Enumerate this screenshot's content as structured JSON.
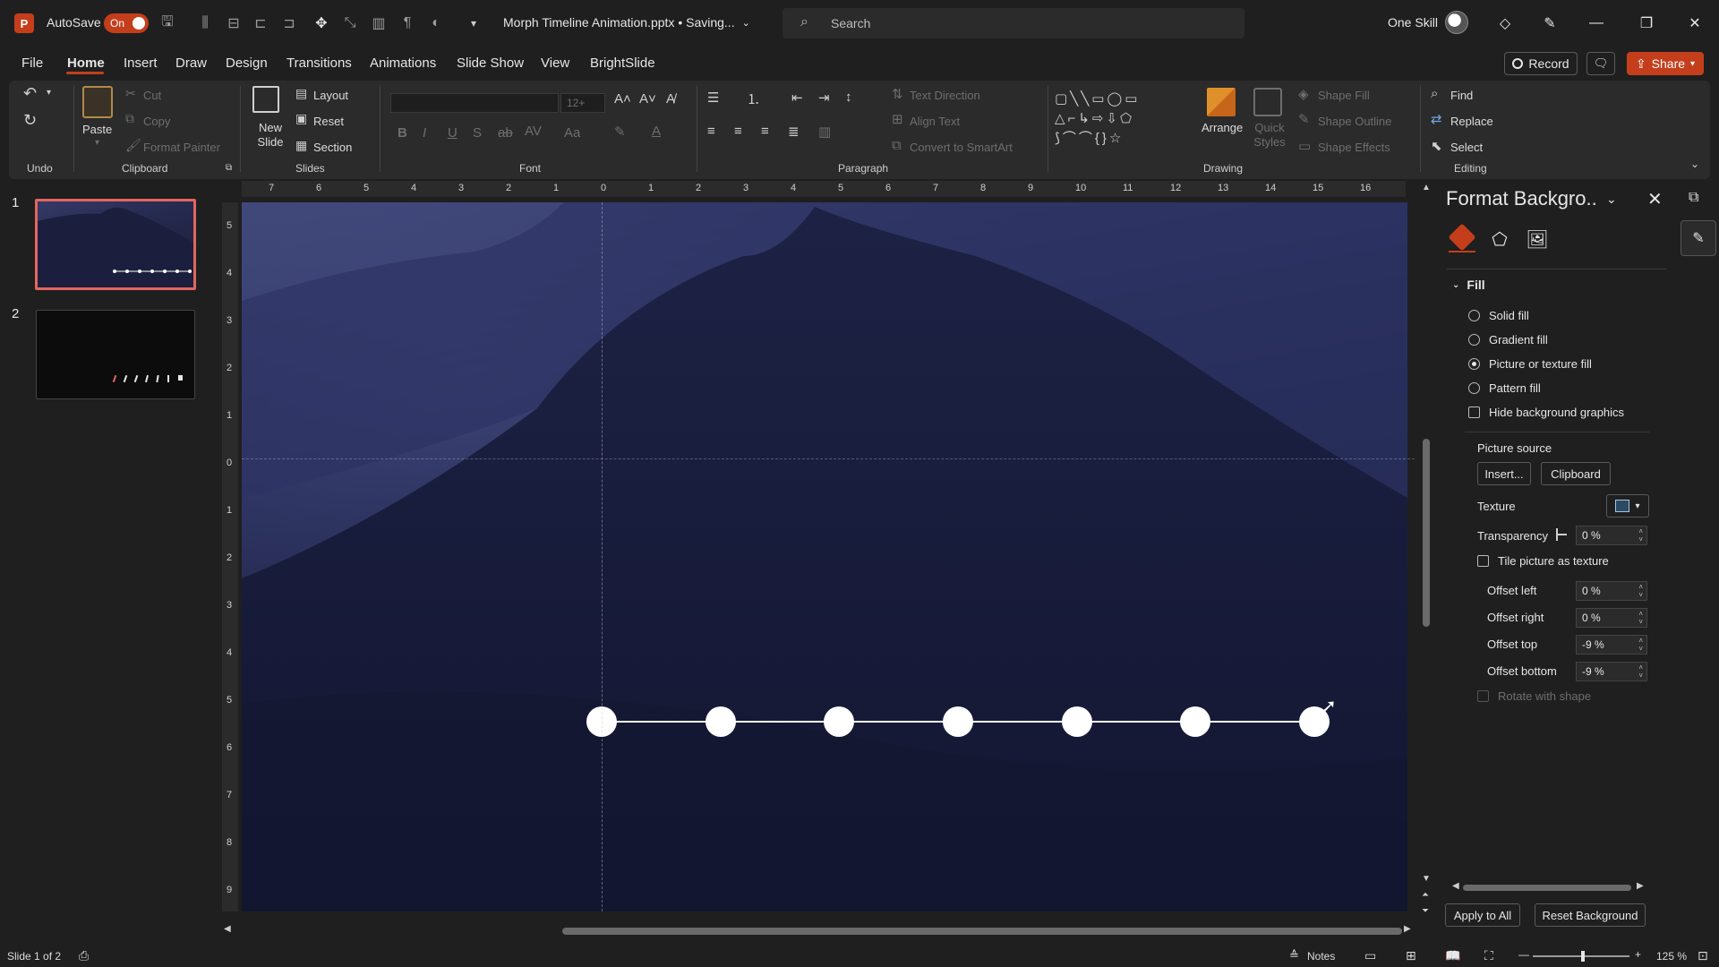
{
  "titlebar": {
    "app_badge": "P",
    "autosave_label": "AutoSave",
    "autosave_state": "On",
    "doc_title": "Morph Timeline Animation.pptx • Saving...",
    "search_placeholder": "Search",
    "user_name": "One Skill"
  },
  "menu": {
    "tabs": [
      "File",
      "Home",
      "Insert",
      "Draw",
      "Design",
      "Transitions",
      "Animations",
      "Slide Show",
      "View",
      "BrightSlide"
    ],
    "active_tab": "Home",
    "record_label": "Record",
    "share_label": "Share"
  },
  "ribbon": {
    "undo_group": "Undo",
    "clipboard": {
      "paste": "Paste",
      "cut": "Cut",
      "copy": "Copy",
      "format_painter": "Format Painter",
      "group": "Clipboard"
    },
    "slides": {
      "new_slide": "New Slide",
      "layout": "Layout",
      "reset": "Reset",
      "section": "Section",
      "group": "Slides"
    },
    "font": {
      "size": "12+",
      "group": "Font"
    },
    "paragraph": {
      "text_direction": "Text Direction",
      "align_text": "Align Text",
      "convert_smartart": "Convert to SmartArt",
      "group": "Paragraph"
    },
    "drawing": {
      "arrange": "Arrange",
      "quick_styles": "Quick Styles",
      "shape_fill": "Shape Fill",
      "shape_outline": "Shape Outline",
      "shape_effects": "Shape Effects",
      "group": "Drawing"
    },
    "editing": {
      "find": "Find",
      "replace": "Replace",
      "select": "Select",
      "group": "Editing"
    }
  },
  "thumbnails": [
    {
      "number": "1",
      "selected": true
    },
    {
      "number": "2",
      "selected": false
    }
  ],
  "rulers": {
    "horizontal": [
      "7",
      "6",
      "5",
      "4",
      "3",
      "2",
      "1",
      "0",
      "1",
      "2",
      "3",
      "4",
      "5",
      "6",
      "7",
      "8",
      "9",
      "10",
      "11",
      "12",
      "13",
      "14",
      "15",
      "16"
    ],
    "vertical": [
      "5",
      "4",
      "3",
      "2",
      "1",
      "0",
      "1",
      "2",
      "3",
      "4",
      "5",
      "6",
      "7",
      "8",
      "9"
    ]
  },
  "timeline": {
    "dot_count": 7,
    "color": "#ffffff"
  },
  "format_pane": {
    "title": "Format Backgro..",
    "section": "Fill",
    "options": [
      {
        "label": "Solid fill",
        "selected": false
      },
      {
        "label": "Gradient fill",
        "selected": false
      },
      {
        "label": "Picture or texture fill",
        "selected": true
      },
      {
        "label": "Pattern fill",
        "selected": false
      }
    ],
    "hide_bg_graphics": "Hide background graphics",
    "picture_source": "Picture source",
    "insert_btn": "Insert...",
    "clipboard_btn": "Clipboard",
    "texture": "Texture",
    "transparency": "Transparency",
    "transparency_value": "0 %",
    "tile_label": "Tile picture as texture",
    "offsets": [
      {
        "label": "Offset left",
        "value": "0 %"
      },
      {
        "label": "Offset right",
        "value": "0 %"
      },
      {
        "label": "Offset top",
        "value": "-9 %"
      },
      {
        "label": "Offset bottom",
        "value": "-9 %"
      }
    ],
    "rotate_label": "Rotate with shape",
    "apply_all": "Apply to All",
    "reset_bg": "Reset Background"
  },
  "status": {
    "slide_info": "Slide 1 of 2",
    "notes": "Notes",
    "zoom": "125 %"
  },
  "colors": {
    "accent": "#c43e1c",
    "background": "#1f1f1f",
    "ribbon": "#2b2b2b"
  }
}
